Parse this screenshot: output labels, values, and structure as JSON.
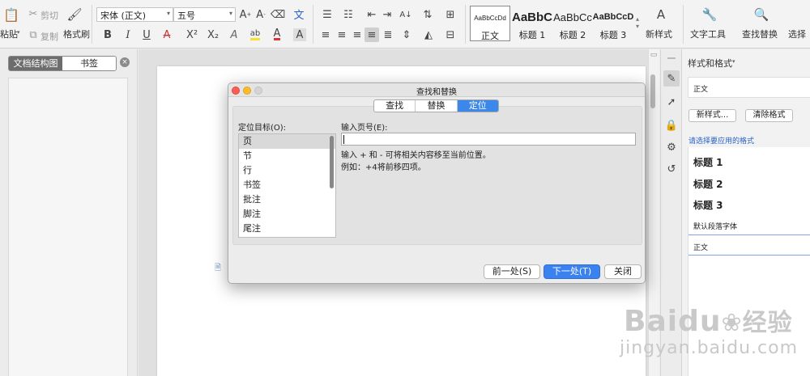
{
  "ribbon": {
    "paste": "粘贴",
    "cut": "剪切",
    "copy": "复制",
    "format_painter": "格式刷",
    "font_name": "宋体 (正文)",
    "font_size": "五号",
    "bold": "B",
    "italic": "I",
    "underline": "U",
    "strike": "A",
    "superscript": "X²",
    "subscript": "X₂",
    "pinyin": "文",
    "char_border": "A",
    "styles": [
      {
        "preview": "AaBbCcDd",
        "label": "正文"
      },
      {
        "preview": "AaBbC",
        "label": "标题 1"
      },
      {
        "preview": "AaBbCc",
        "label": "标题 2"
      },
      {
        "preview": "AaBbCcD",
        "label": "标题 3"
      }
    ],
    "new_style": "新样式",
    "text_tools": "文字工具",
    "find_replace": "查找替换",
    "select": "选择"
  },
  "left_panel": {
    "tab_outline": "文档结构图",
    "tab_bookmark": "书签"
  },
  "right_panel": {
    "title": "样式和格式",
    "current_style": "正文",
    "new_style_btn": "新样式...",
    "clear_format_btn": "清除格式",
    "apply_hint": "请选择要应用的格式",
    "items": [
      "标题 1",
      "标题 2",
      "标题 3",
      "默认段落字体",
      "正文"
    ]
  },
  "dialog": {
    "title": "查找和替换",
    "tabs": [
      "查找",
      "替换",
      "定位"
    ],
    "active_tab": "定位",
    "target_label": "定位目标(O):",
    "targets": [
      "页",
      "节",
      "行",
      "书签",
      "批注",
      "脚注",
      "尾注"
    ],
    "selected_target": "页",
    "input_label": "输入页号(E):",
    "input_value": "",
    "hint_line1": "输入 + 和 - 可将相关内容移至当前位置。",
    "hint_line2": "例如：+4将前移四项。",
    "prev_btn": "前一处(S)",
    "next_btn": "下一处(T)",
    "close_btn": "关闭"
  },
  "watermark": {
    "brand": "Baidu",
    "brand_cn": "经验",
    "url": "jingyan.baidu.com"
  },
  "colors": {
    "accent": "#3b87ea",
    "font_color_red": "#d33",
    "highlight_yellow": "#f7e12a"
  }
}
